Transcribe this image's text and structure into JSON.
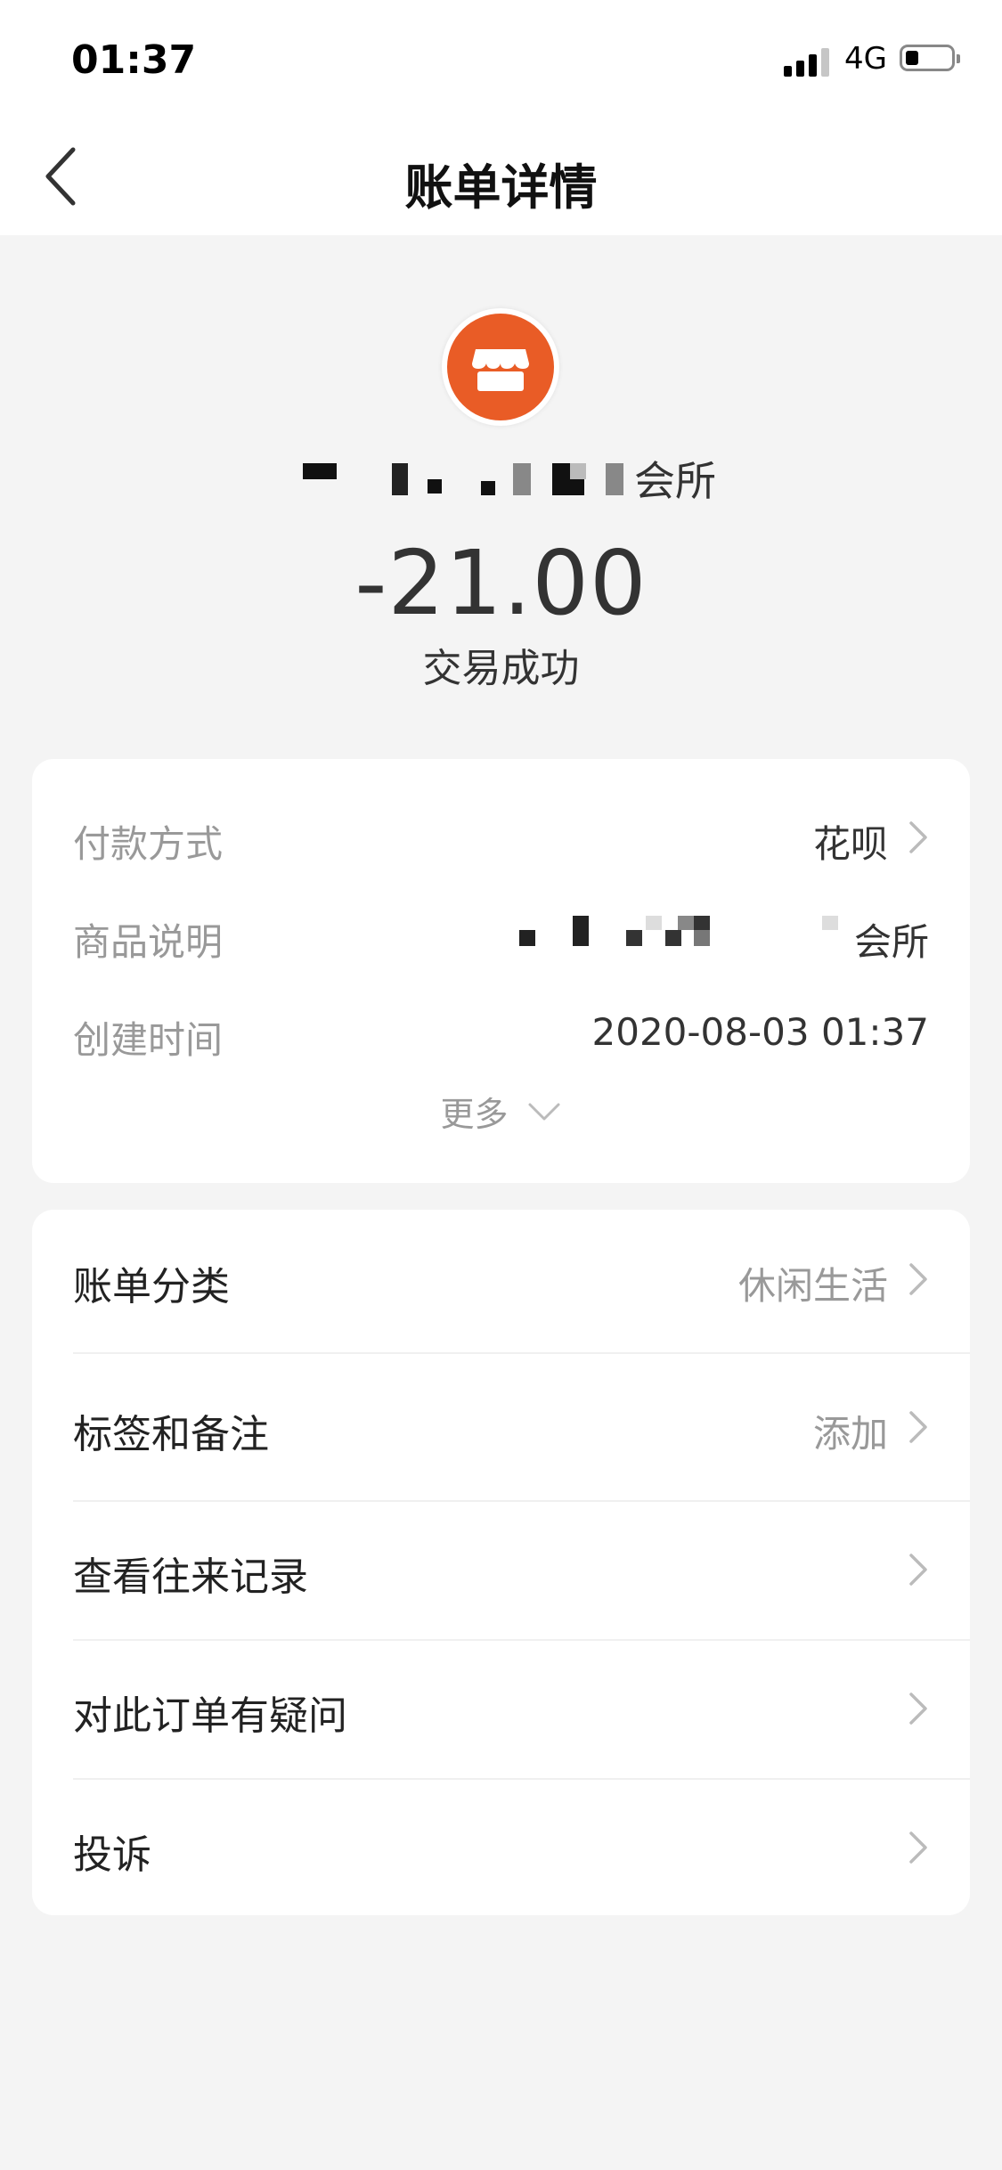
{
  "status_bar": {
    "time": "01:37",
    "network": "4G"
  },
  "nav": {
    "title": "账单详情"
  },
  "merchant": {
    "name_suffix": "会所"
  },
  "amount": "-21.00",
  "status": "交易成功",
  "details": {
    "payment_method_label": "付款方式",
    "payment_method_value": "花呗",
    "product_label": "商品说明",
    "product_value_suffix": "会所",
    "created_label": "创建时间",
    "created_value": "2020-08-03 01:37",
    "more_label": "更多"
  },
  "actions": [
    {
      "label": "账单分类",
      "value": "休闲生活"
    },
    {
      "label": "标签和备注",
      "value": "添加"
    },
    {
      "label": "查看往来记录",
      "value": ""
    },
    {
      "label": "对此订单有疑问",
      "value": ""
    },
    {
      "label": "投诉",
      "value": ""
    }
  ],
  "colors": {
    "accent": "#e95c26",
    "background": "#f4f4f4"
  }
}
